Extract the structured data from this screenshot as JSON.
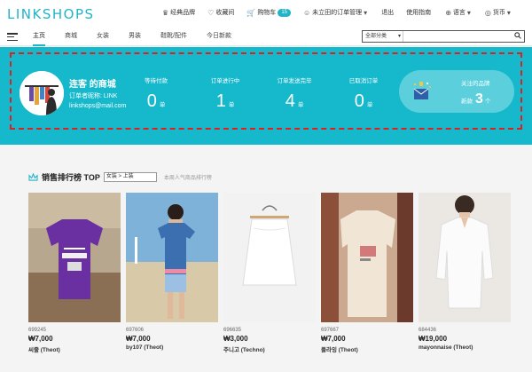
{
  "app": {
    "logo": "LINKSHOPS"
  },
  "toplinks": [
    {
      "icon": "crown-icon",
      "glyph": "♛",
      "label": "经典品牌"
    },
    {
      "icon": "heart-icon",
      "glyph": "♡",
      "label": "收藏间"
    },
    {
      "icon": "cart-icon",
      "glyph": "🛒",
      "label": "购物车",
      "badge": "15"
    },
    {
      "icon": "user-icon",
      "glyph": "☺",
      "label": "未立田的订单管理",
      "caret": "▾"
    },
    {
      "icon": "",
      "glyph": "",
      "label": "退出"
    },
    {
      "icon": "",
      "glyph": "",
      "label": "使用指南"
    },
    {
      "icon": "globe-icon",
      "glyph": "⊕",
      "label": "语言",
      "caret": "▾"
    },
    {
      "icon": "currency-icon",
      "glyph": "◎",
      "label": "货币",
      "caret": "▾"
    }
  ],
  "nav": {
    "tabs": [
      "主页",
      "商城",
      "女装",
      "男装",
      "鞋靴/配件",
      "今日新款"
    ],
    "active_index": 0
  },
  "search": {
    "category": "全部分类",
    "caret": "▾",
    "placeholder": ""
  },
  "hero": {
    "shop_name": "连客 的商城",
    "shop_sub": "订单者昵称: LINK",
    "shop_mail": "linkshops@mail.com",
    "stats": [
      {
        "label": "等待付款",
        "value": "0",
        "unit": "单"
      },
      {
        "label": "订单进行中",
        "value": "1",
        "unit": "单"
      },
      {
        "label": "订单发送完毕",
        "value": "4",
        "unit": "单"
      },
      {
        "label": "已取消订单",
        "value": "0",
        "unit": "单"
      }
    ],
    "brand": {
      "title": "关注的品牌",
      "new_label": "新款",
      "new_count": "3",
      "unit": "个"
    }
  },
  "ranking": {
    "title": "销售排行榜 TOP",
    "select": "女装 > 上装",
    "note": "本周人气商品排行榜",
    "products": [
      {
        "code": "699245",
        "price": "₩7,000",
        "maker": "씨줄 (Theot)"
      },
      {
        "code": "697606",
        "price": "₩7,000",
        "maker": "by107 (Theot)"
      },
      {
        "code": "696635",
        "price": "₩3,000",
        "maker": "주니고 (Techno)"
      },
      {
        "code": "697667",
        "price": "₩7,000",
        "maker": "플라잉 (Theot)"
      },
      {
        "code": "684436",
        "price": "₩19,000",
        "maker": "mayonnaise (Theot)"
      }
    ]
  },
  "colors": {
    "accent": "#16b8cb",
    "highlight_border": "#e02020"
  }
}
